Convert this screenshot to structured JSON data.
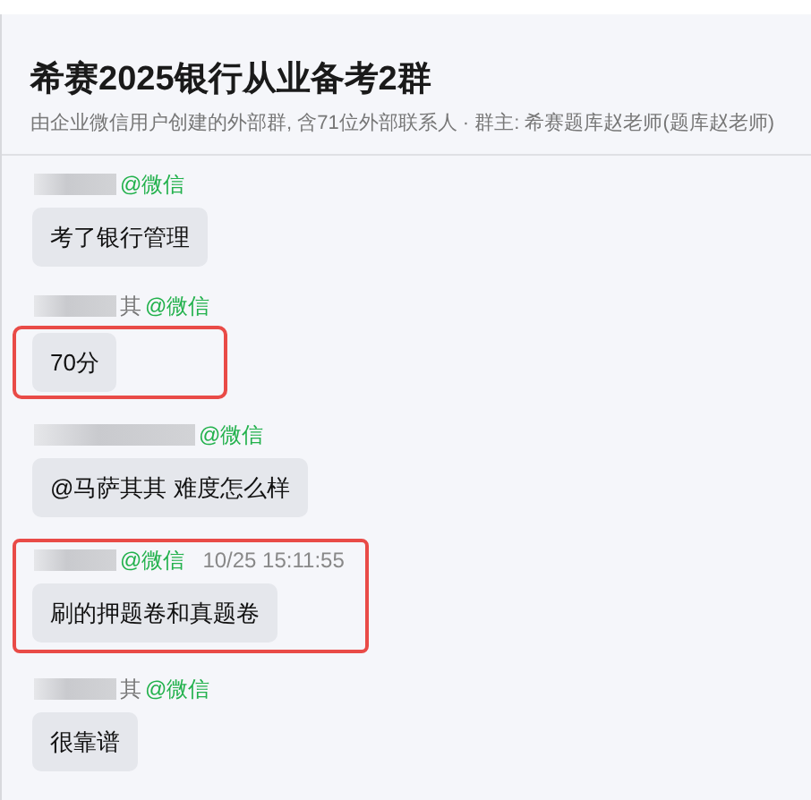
{
  "header": {
    "title": "希赛2025银行从业备考2群",
    "subtitle": "由企业微信用户创建的外部群, 含71位外部联系人 · 群主: 希赛题库赵老师(题库赵老师)"
  },
  "messages": [
    {
      "sender": {
        "source": "@微信"
      },
      "text": "考了银行管理"
    },
    {
      "sender": {
        "name_tail": "其",
        "source": "@微信"
      },
      "text": "70分",
      "highlighted": true,
      "highlight_covers_header": false
    },
    {
      "sender": {
        "source": "@微信",
        "wide": true
      },
      "text": "@马萨其其 难度怎么样"
    },
    {
      "sender": {
        "source": "@微信",
        "time": "10/25 15:11:55"
      },
      "text": "刷的押题卷和真题卷",
      "highlighted": true,
      "highlight_covers_header": true
    },
    {
      "sender": {
        "name_tail": "其",
        "source": "@微信"
      },
      "text": "很靠谱"
    }
  ]
}
